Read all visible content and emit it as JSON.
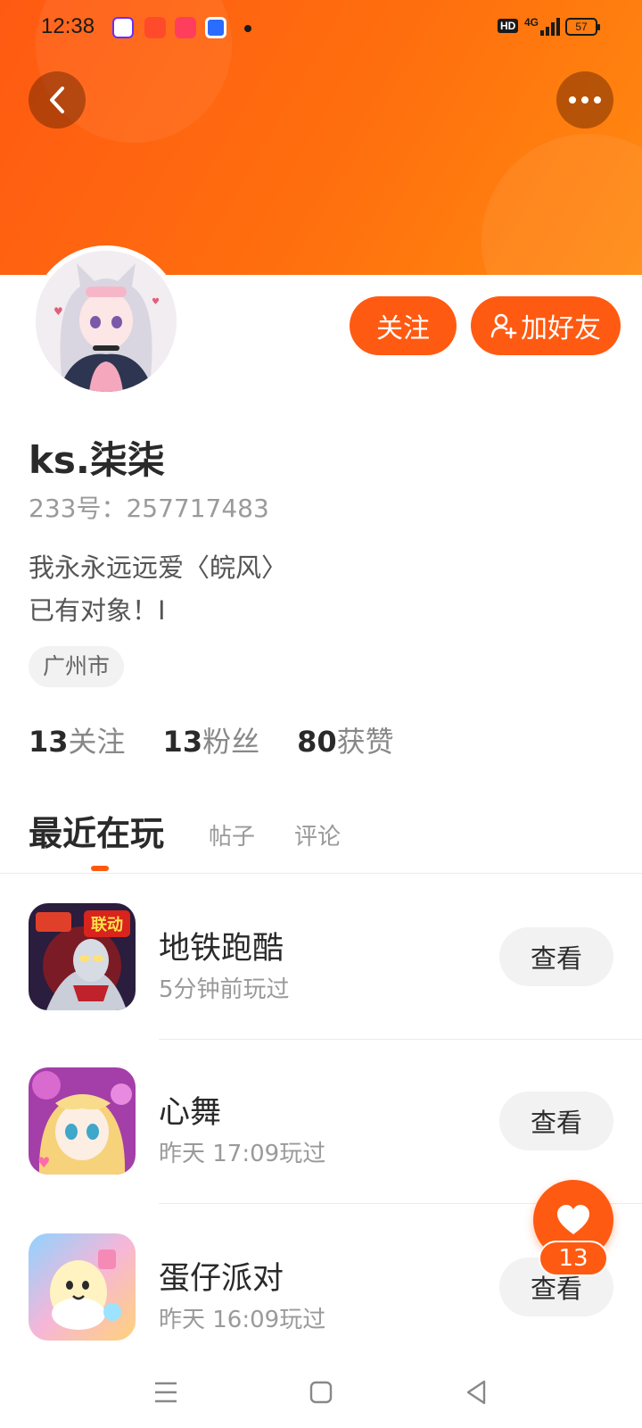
{
  "status_bar": {
    "time": "12:38",
    "hd": "HD",
    "network": "4G",
    "battery": "57"
  },
  "profile": {
    "username": "ks.柒柒",
    "uid": "233号：257717483",
    "bio_line1": "我永永远远爱〈皖风〉",
    "bio_line2": "已有对象！I",
    "location": "广州市"
  },
  "actions": {
    "follow": "关注",
    "add_friend": "加好友"
  },
  "stats": {
    "following": {
      "num": "13",
      "label": "关注"
    },
    "fans": {
      "num": "13",
      "label": "粉丝"
    },
    "likes": {
      "num": "80",
      "label": "获赞"
    }
  },
  "tabs": [
    "最近在玩",
    "帖子",
    "评论"
  ],
  "games": [
    {
      "name": "地铁跑酷",
      "time": "5分钟前玩过",
      "button": "查看",
      "icon": "subway-surfers-icon",
      "badge": "联动"
    },
    {
      "name": "心舞",
      "time": "昨天 17:09玩过",
      "button": "查看",
      "icon": "xinwu-icon"
    },
    {
      "name": "蛋仔派对",
      "time": "昨天 16:09玩过",
      "button": "查看",
      "icon": "eggy-party-icon"
    }
  ],
  "float_like": {
    "count": "13"
  },
  "colors": {
    "accent": "#ff5a12",
    "banner_end": "#ff8a10"
  }
}
